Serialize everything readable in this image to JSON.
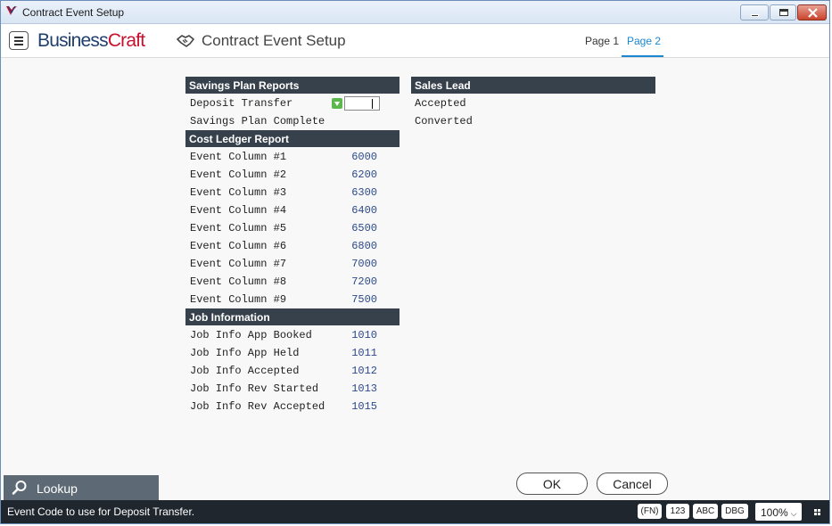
{
  "window": {
    "title": "Contract Event Setup"
  },
  "header": {
    "brand_part1": "Business",
    "brand_part2": "Craft",
    "page_title": "Contract Event Setup",
    "tabs": [
      {
        "label": "Page 1",
        "active": false
      },
      {
        "label": "Page 2",
        "active": true
      }
    ]
  },
  "savings_plan": {
    "heading": "Savings Plan Reports",
    "rows": [
      {
        "label": "Deposit Transfer",
        "value": ""
      },
      {
        "label": "Savings Plan Complete",
        "value": ""
      }
    ]
  },
  "cost_ledger": {
    "heading": "Cost Ledger Report",
    "rows": [
      {
        "label": "Event Column #1",
        "value": "6000"
      },
      {
        "label": "Event Column #2",
        "value": "6200"
      },
      {
        "label": "Event Column #3",
        "value": "6300"
      },
      {
        "label": "Event Column #4",
        "value": "6400"
      },
      {
        "label": "Event Column #5",
        "value": "6500"
      },
      {
        "label": "Event Column #6",
        "value": "6800"
      },
      {
        "label": "Event Column #7",
        "value": "7000"
      },
      {
        "label": "Event Column #8",
        "value": "7200"
      },
      {
        "label": "Event Column #9",
        "value": "7500"
      }
    ]
  },
  "job_information": {
    "heading": "Job Information",
    "rows": [
      {
        "label": "Job Info App Booked",
        "value": "1010"
      },
      {
        "label": "Job Info App Held",
        "value": "1011"
      },
      {
        "label": "Job Info Accepted",
        "value": "1012"
      },
      {
        "label": "Job Info Rev Started",
        "value": "1013"
      },
      {
        "label": "Job Info Rev Accepted",
        "value": "1015"
      }
    ]
  },
  "sales_lead": {
    "heading": "Sales Lead",
    "rows": [
      {
        "label": "Accepted"
      },
      {
        "label": "Converted"
      }
    ]
  },
  "buttons": {
    "ok": "OK",
    "cancel": "Cancel"
  },
  "lookup": {
    "label": "Lookup"
  },
  "statusbar": {
    "message": "Event Code to use for Deposit Transfer.",
    "fn": "(FN)",
    "num": "123",
    "abc": "ABC",
    "dbg": "DBG",
    "zoom": "100%"
  },
  "colors": {
    "accent": "#1b87d0",
    "section_header": "#37414b",
    "statusbar": "#1f262d",
    "brand_blue": "#1f3f6e",
    "brand_red": "#c8102e",
    "value_text": "#2c4a8a"
  }
}
